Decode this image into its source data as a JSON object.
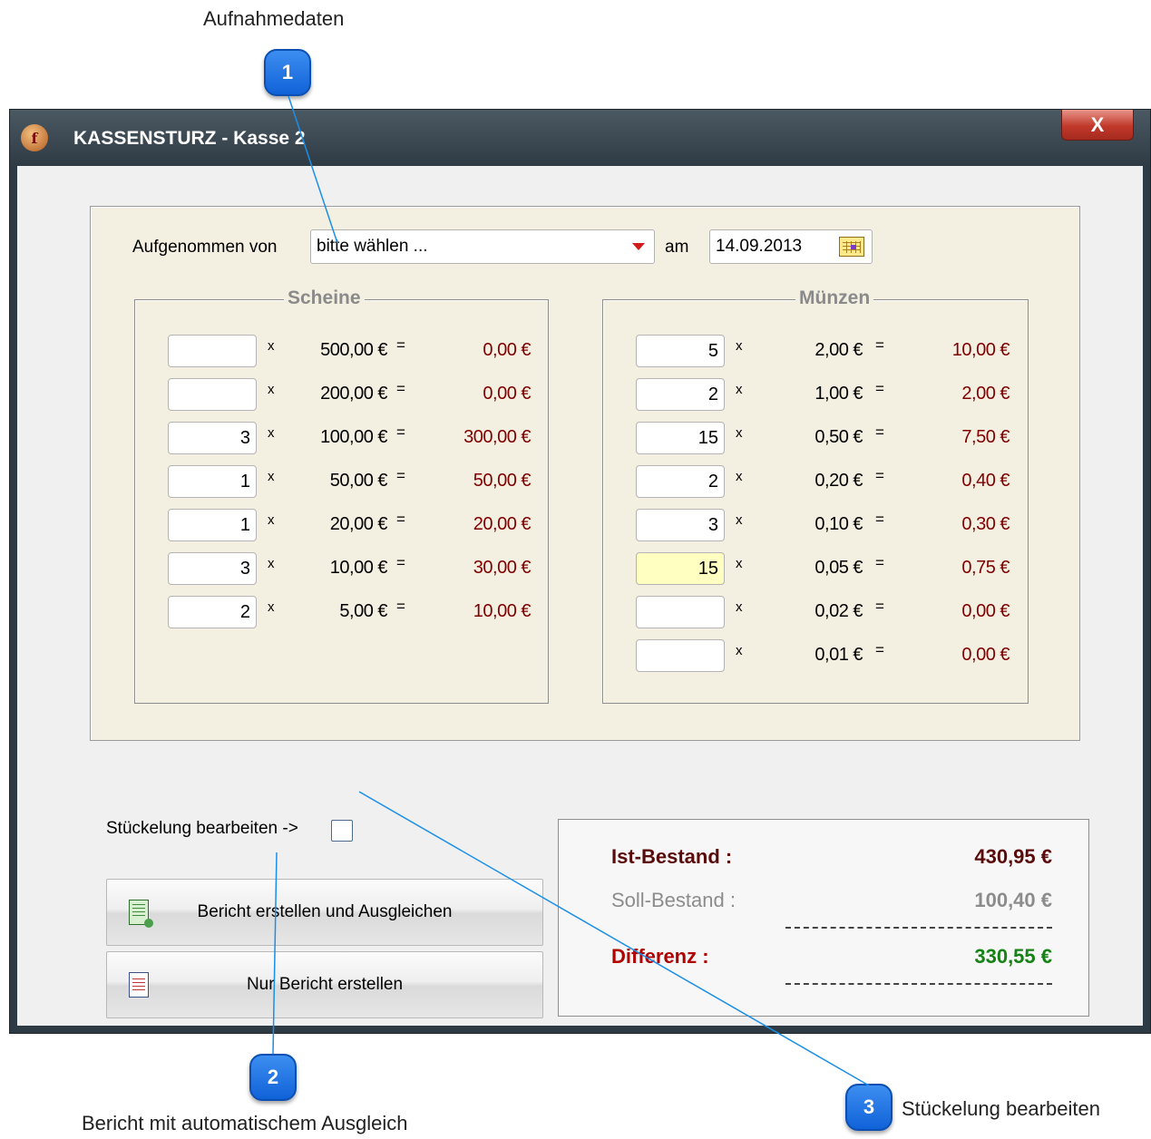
{
  "callouts": {
    "c1": {
      "number": "1",
      "text": "Aufnahmedaten"
    },
    "c2": {
      "number": "2",
      "text": "Bericht mit automatischem Ausgleich"
    },
    "c3": {
      "number": "3",
      "text": "Stückelung bearbeiten"
    }
  },
  "window": {
    "title": "KASSENSTURZ - Kasse 2",
    "icon_letter": "f",
    "close_label": "X"
  },
  "recorded": {
    "by_label": "Aufgenommen von",
    "by_value": "bitte wählen ...",
    "on_label": "am",
    "date_value": "14.09.2013"
  },
  "notes": {
    "title": "Scheine",
    "rows": [
      {
        "qty": "",
        "denom": "500,00 €",
        "total": "0,00 €"
      },
      {
        "qty": "",
        "denom": "200,00 €",
        "total": "0,00 €"
      },
      {
        "qty": "3",
        "denom": "100,00 €",
        "total": "300,00 €"
      },
      {
        "qty": "1",
        "denom": "50,00 €",
        "total": "50,00 €"
      },
      {
        "qty": "1",
        "denom": "20,00 €",
        "total": "20,00 €"
      },
      {
        "qty": "3",
        "denom": "10,00 €",
        "total": "30,00 €"
      },
      {
        "qty": "2",
        "denom": "5,00 €",
        "total": "10,00 €"
      }
    ]
  },
  "coins": {
    "title": "Münzen",
    "rows": [
      {
        "qty": "5",
        "denom": "2,00 €",
        "total": "10,00 €"
      },
      {
        "qty": "2",
        "denom": "1,00 €",
        "total": "2,00 €"
      },
      {
        "qty": "15",
        "denom": "0,50 €",
        "total": "7,50 €"
      },
      {
        "qty": "2",
        "denom": "0,20 €",
        "total": "0,40 €"
      },
      {
        "qty": "3",
        "denom": "0,10 €",
        "total": "0,30 €"
      },
      {
        "qty": "15",
        "denom": "0,05 €",
        "total": "0,75 €"
      },
      {
        "qty": "",
        "denom": "0,02 €",
        "total": "0,00 €"
      },
      {
        "qty": "",
        "denom": "0,01 €",
        "total": "0,00 €"
      }
    ]
  },
  "symbols": {
    "times": "x",
    "equals": "="
  },
  "edit_denominations": {
    "label": "Stückelung bearbeiten ->",
    "checked": false
  },
  "buttons": {
    "report_balance": "Bericht erstellen und Ausgleichen",
    "report_only": "Nur Bericht erstellen"
  },
  "summary": {
    "actual_label": "Ist-Bestand :",
    "actual_value": "430,95 €",
    "target_label": "Soll-Bestand :",
    "target_value": "100,40 €",
    "diff_label": "Differenz :",
    "diff_value": "330,55 €"
  },
  "colors": {
    "amount": "#800000",
    "actual": "#5a0a0a",
    "target": "#8c8c8c",
    "diff_label": "#b00000",
    "diff_value": "#148214",
    "callout": "#1a6fe0"
  }
}
